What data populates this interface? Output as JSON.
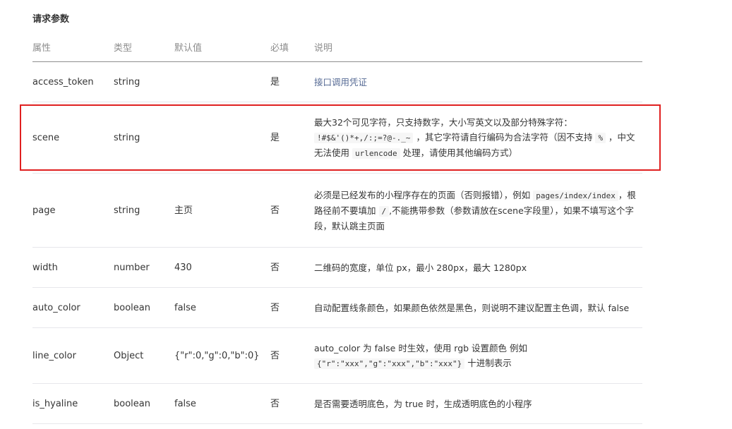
{
  "section_title": "请求参数",
  "headers": {
    "name": "属性",
    "type": "类型",
    "default": "默认值",
    "required": "必填",
    "desc": "说明"
  },
  "rows": [
    {
      "name": "access_token",
      "type": "string",
      "default": "",
      "required": "是",
      "desc": {
        "link": "接口调用凭证"
      }
    },
    {
      "name": "scene",
      "type": "string",
      "default": "",
      "required": "是",
      "desc": {
        "line1": "最大32个可见字符，只支持数字，大小写英文以及部分特殊字符：",
        "code1": "!#$&'()*+,/:;=?@-._~",
        "text2": "，其它字符请自行编码为合法字符（因不支持",
        "code2": "%",
        "text3": "，中文无法使用",
        "code3": "urlencode",
        "text4": "处理，请使用其他编码方式）"
      }
    },
    {
      "name": "page",
      "type": "string",
      "default": "主页",
      "required": "否",
      "desc": {
        "text1": "必须是已经发布的小程序存在的页面（否则报错），例如",
        "code1": "pages/index/index",
        "text2": "，根路径前不要填加",
        "code2": "/",
        "text3": ",不能携带参数（参数请放在scene字段里），如果不填写这个字段，默认跳主页面"
      }
    },
    {
      "name": "width",
      "type": "number",
      "default": "430",
      "required": "否",
      "desc": {
        "text": "二维码的宽度，单位 px，最小 280px，最大 1280px"
      }
    },
    {
      "name": "auto_color",
      "type": "boolean",
      "default": "false",
      "required": "否",
      "desc": {
        "text": "自动配置线条颜色，如果颜色依然是黑色，则说明不建议配置主色调，默认 false"
      }
    },
    {
      "name": "line_color",
      "type": "Object",
      "default": "{\"r\":0,\"g\":0,\"b\":0}",
      "required": "否",
      "desc": {
        "line1": "auto_color 为 false 时生效，使用 rgb 设置颜色 例如",
        "code1": "{\"r\":\"xxx\",\"g\":\"xxx\",\"b\":\"xxx\"}",
        "text2": "十进制表示"
      }
    },
    {
      "name": "is_hyaline",
      "type": "boolean",
      "default": "false",
      "required": "否",
      "desc": {
        "text": "是否需要透明底色，为 true 时，生成透明底色的小程序"
      }
    }
  ],
  "colors": {
    "highlight_border": "#e02020",
    "link": "#576b95",
    "header_text": "#8d8d8d",
    "row_divider": "#e7e7eb"
  }
}
